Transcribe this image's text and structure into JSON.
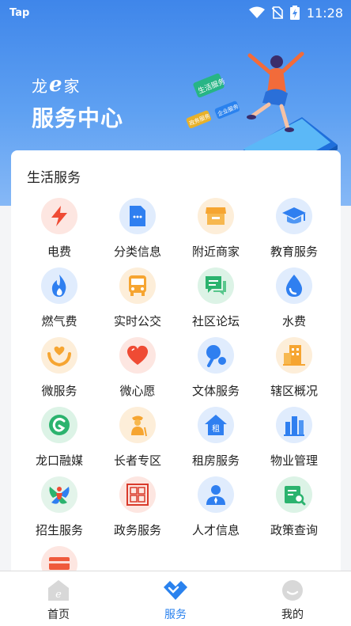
{
  "status_bar": {
    "app_label": "Tap",
    "time": "11:28"
  },
  "brand": {
    "prefix": "龙",
    "letter": "e",
    "suffix": "家",
    "title": "服务中心"
  },
  "illustration": {
    "tag1": "生活服务",
    "tag2": "企业服务",
    "tag3": "政务服务"
  },
  "section": {
    "title": "生活服务"
  },
  "services": [
    {
      "label": "电费",
      "icon": "lightning-icon"
    },
    {
      "label": "分类信息",
      "icon": "document-icon"
    },
    {
      "label": "附近商家",
      "icon": "shop-icon"
    },
    {
      "label": "教育服务",
      "icon": "graduation-cap-icon"
    },
    {
      "label": "燃气费",
      "icon": "flame-icon"
    },
    {
      "label": "实时公交",
      "icon": "bus-icon"
    },
    {
      "label": "社区论坛",
      "icon": "chat-icon"
    },
    {
      "label": "水费",
      "icon": "water-drop-icon"
    },
    {
      "label": "微服务",
      "icon": "hand-heart-icon"
    },
    {
      "label": "微心愿",
      "icon": "heart-icon"
    },
    {
      "label": "文体服务",
      "icon": "ping-pong-icon"
    },
    {
      "label": "辖区概况",
      "icon": "buildings-icon"
    },
    {
      "label": "龙口融媒",
      "icon": "media-logo-icon"
    },
    {
      "label": "长者专区",
      "icon": "elder-icon"
    },
    {
      "label": "租房服务",
      "icon": "rent-house-icon"
    },
    {
      "label": "物业管理",
      "icon": "property-building-icon"
    },
    {
      "label": "招生服务",
      "icon": "enrollment-logo-icon"
    },
    {
      "label": "政务服务",
      "icon": "government-seal-icon"
    },
    {
      "label": "人才信息",
      "icon": "talent-person-icon"
    },
    {
      "label": "政策查询",
      "icon": "policy-search-icon"
    },
    {
      "label": "",
      "icon": "card-icon"
    }
  ],
  "tabbar": {
    "tabs": [
      {
        "label": "首页",
        "icon": "home-icon",
        "active": false
      },
      {
        "label": "服务",
        "icon": "service-handshake-icon",
        "active": true
      },
      {
        "label": "我的",
        "icon": "profile-face-icon",
        "active": false
      }
    ],
    "active_color": "#2a82ee"
  }
}
